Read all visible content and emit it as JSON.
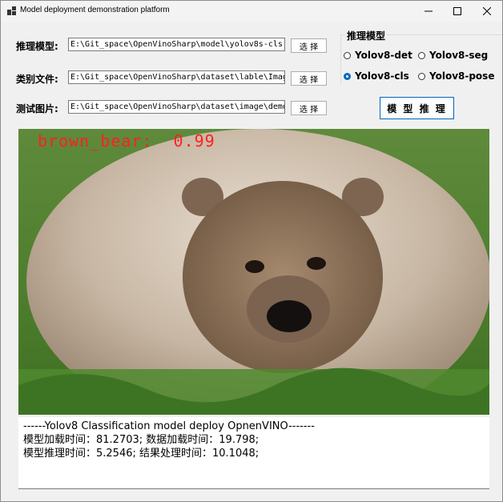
{
  "window": {
    "title": "Model deployment demonstration platform"
  },
  "form": {
    "model": {
      "label": "推理模型:",
      "path": "E:\\Git_space\\OpenVinoSharp\\model\\yolov8s-cls",
      "button": "选 择"
    },
    "classes": {
      "label": "类别文件:",
      "path": "E:\\Git_space\\OpenVinoSharp\\dataset\\lable\\ImageNet",
      "button": "选 择"
    },
    "image": {
      "label": "测试图片:",
      "path": "E:\\Git_space\\OpenVinoSharp\\dataset\\image\\demo",
      "button": "选 择"
    }
  },
  "model_group": {
    "title": "推理模型",
    "options": [
      {
        "label": "Yolov8-det",
        "selected": false
      },
      {
        "label": "Yolov8-seg",
        "selected": false
      },
      {
        "label": "Yolov8-cls",
        "selected": true
      },
      {
        "label": "Yolov8-pose",
        "selected": false
      }
    ]
  },
  "infer_button": "模 型 推 理",
  "result": {
    "label": "brown_bear:  0.99",
    "color": "#ff2020"
  },
  "output": {
    "lines": [
      "------Yolov8 Classification model deploy OpnenVINO-------",
      "模型加载时间：81.2703; 数据加载时间：19.798;",
      "模型推理时间：5.2546; 结果处理时间：10.1048;"
    ]
  }
}
